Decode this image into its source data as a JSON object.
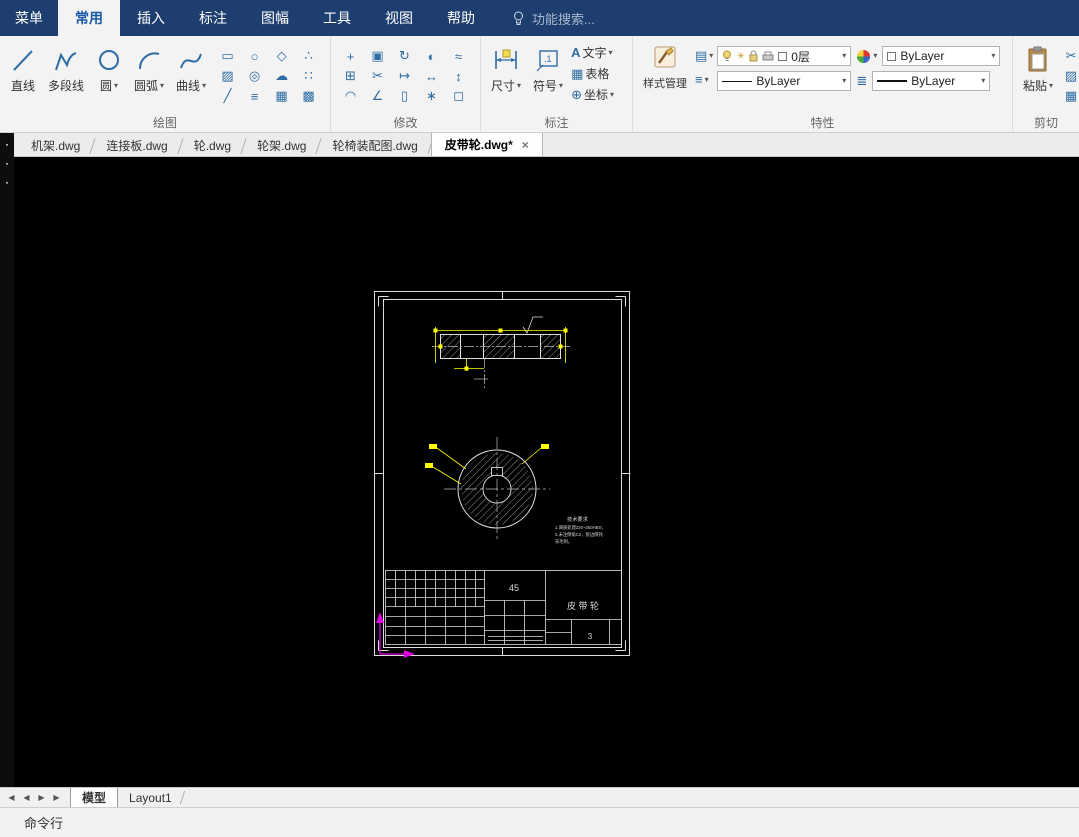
{
  "glyphs": {
    "caret": "▾",
    "close": "×",
    "sun": "☀",
    "square": "□",
    "rows": "▤",
    "lines": "≡",
    "thick_lines": "≣"
  },
  "menubar": {
    "menu_label": "菜单",
    "tabs": [
      {
        "label": "常用"
      },
      {
        "label": "插入"
      },
      {
        "label": "标注"
      },
      {
        "label": "图幅"
      },
      {
        "label": "工具"
      },
      {
        "label": "视图"
      },
      {
        "label": "帮助"
      }
    ],
    "search_text": "功能搜索..."
  },
  "ribbon": {
    "draw": {
      "label": "绘图",
      "big": [
        {
          "label": "直线"
        },
        {
          "label": "多段线"
        },
        {
          "label": "圆"
        },
        {
          "label": "圆弧"
        },
        {
          "label": "曲线"
        }
      ],
      "small": [
        {
          "name": "rectangle",
          "glyph": "▭"
        },
        {
          "name": "ellipse",
          "glyph": "○"
        },
        {
          "name": "polygon",
          "glyph": "◇"
        },
        {
          "name": "point",
          "glyph": "∴"
        },
        {
          "name": "hatch",
          "glyph": "▨"
        },
        {
          "name": "donut",
          "glyph": "◎"
        },
        {
          "name": "revision-cloud",
          "glyph": "☁"
        },
        {
          "name": "divide",
          "glyph": "∷"
        },
        {
          "name": "construction-line",
          "glyph": "╱"
        },
        {
          "name": "multiline",
          "glyph": "≡"
        },
        {
          "name": "region",
          "glyph": "▦"
        },
        {
          "name": "wipeout",
          "glyph": "▩"
        }
      ]
    },
    "modify": {
      "label": "修改",
      "small": [
        {
          "name": "move",
          "glyph": "+"
        },
        {
          "name": "copy",
          "glyph": "▣"
        },
        {
          "name": "rotate",
          "glyph": "↻"
        },
        {
          "name": "mirror",
          "glyph": "◐"
        },
        {
          "name": "offset",
          "glyph": "≈"
        },
        {
          "name": "array",
          "glyph": "⊞"
        },
        {
          "name": "trim",
          "glyph": "✂"
        },
        {
          "name": "extend",
          "glyph": "↦"
        },
        {
          "name": "stretch",
          "glyph": "↔"
        },
        {
          "name": "scale",
          "glyph": "↕"
        },
        {
          "name": "fillet",
          "glyph": "◠"
        },
        {
          "name": "chamfer",
          "glyph": "∠"
        },
        {
          "name": "break",
          "glyph": "▯"
        },
        {
          "name": "explode",
          "glyph": "∗"
        },
        {
          "name": "erase",
          "glyph": "◻"
        }
      ]
    },
    "annotate": {
      "label": "标注",
      "dimension_label": "尺寸",
      "symbol_label": "符号",
      "symbol_icon_text": ".1",
      "stack": [
        {
          "icon": "A",
          "label": "文字"
        },
        {
          "icon": "▦",
          "label": "表格"
        },
        {
          "icon": "⊕",
          "label": "坐标"
        }
      ]
    },
    "props": {
      "label": "特性",
      "style_label": "样式管理",
      "layer_value": "0层",
      "color_value": "ByLayer",
      "linetype_value": "ByLayer",
      "lineweight_value": "ByLayer"
    },
    "clip": {
      "label": "剪切",
      "paste_label": "粘贴",
      "small": [
        {
          "name": "cut",
          "glyph": "✂"
        },
        {
          "name": "format-brush",
          "glyph": "▨"
        },
        {
          "name": "copy-clip",
          "glyph": "▦"
        }
      ]
    }
  },
  "doctabs": [
    {
      "label": "机架.dwg"
    },
    {
      "label": "连接板.dwg"
    },
    {
      "label": "轮.dwg"
    },
    {
      "label": "轮架.dwg"
    },
    {
      "label": "轮椅装配图.dwg"
    },
    {
      "label": "皮带轮.dwg*"
    }
  ],
  "drawing": {
    "material": "45",
    "part_name": "皮 带 轮",
    "sheet_no": "3",
    "notes": [
      "技术要求",
      "1.调质处理220~250HBS；",
      "2.未注倒角C2，锐边倒钝",
      "去毛刺。"
    ]
  },
  "statusbar": {
    "nav": [
      {
        "name": "nav-first",
        "glyph": "◀"
      },
      {
        "name": "nav-prev",
        "glyph": "◀"
      },
      {
        "name": "nav-next",
        "glyph": "▶"
      },
      {
        "name": "nav-last",
        "glyph": "▶"
      }
    ],
    "model_tab": "模型",
    "layout_tab": "Layout1"
  },
  "cmd": {
    "label": "命令行"
  },
  "side_strip": {
    "icons": [
      {
        "name": "palette-a",
        "glyph": "▪"
      },
      {
        "name": "palette-b",
        "glyph": "▪"
      },
      {
        "name": "palette-c",
        "glyph": "▪"
      }
    ]
  },
  "colors": {
    "titlebar": "#1d3e6f",
    "accent_blue": "#2e6da4",
    "canvas_bg": "#000000",
    "highlight_yellow": "#ffff00",
    "ucs_magenta": "#dd00dd"
  }
}
